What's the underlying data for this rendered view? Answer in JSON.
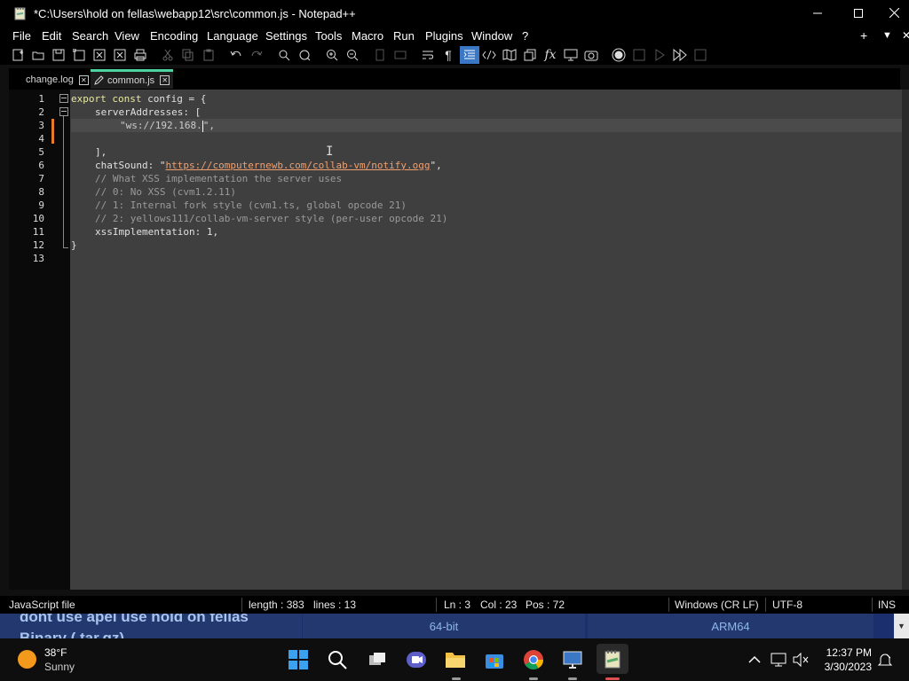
{
  "window": {
    "title": "*C:\\Users\\hold on fellas\\webapp12\\src\\common.js - Notepad++",
    "buttons": {
      "minimize_icon": "minimize-icon",
      "maximize_icon": "maximize-icon",
      "close_icon": "close-icon"
    }
  },
  "menu": {
    "items": [
      "File",
      "Edit",
      "Search",
      "View",
      "Encoding",
      "Language",
      "Settings",
      "Tools",
      "Macro",
      "Run",
      "Plugins",
      "Window",
      "?"
    ],
    "right": [
      "+",
      "▼",
      "✕"
    ]
  },
  "toolbar": {
    "icons": [
      "new-file-icon",
      "open-file-icon",
      "save-icon",
      "save-all-icon",
      "close-icon",
      "close-all-icon",
      "print-icon",
      "cut-icon",
      "copy-icon",
      "paste-icon",
      "undo-icon",
      "redo-icon",
      "find-icon",
      "replace-icon",
      "zoom-in-icon",
      "zoom-out-icon",
      "sync-v-icon",
      "sync-h-icon",
      "word-wrap-icon",
      "show-all-chars-icon",
      "indent-guide-icon",
      "xml-tag-icon",
      "doc-map-icon",
      "doc-list-icon",
      "function-list-icon",
      "folder-workspace-icon",
      "monitor-icon",
      "record-macro-icon",
      "stop-macro-icon",
      "play-macro-icon",
      "run-macro-multiple-icon",
      "save-macro-icon"
    ]
  },
  "tabs": [
    {
      "label": "change.log",
      "active": false
    },
    {
      "label": "common.js",
      "active": true,
      "modified": true
    }
  ],
  "editor": {
    "line_numbers": [
      "1",
      "2",
      "3",
      "4",
      "5",
      "6",
      "7",
      "8",
      "9",
      "10",
      "11",
      "12",
      "13"
    ],
    "lines": {
      "l1_kw1": "export",
      "l1_kw2": "const",
      "l1_rest": " config = {",
      "l2": "serverAddresses: [",
      "l3": "\"ws://192.168.",
      "l3_end": "\",",
      "l5": "],",
      "l6_key": "chatSound: \"",
      "l6_url": "https://computernewb.com/collab-vm/notify.ogg",
      "l6_end": "\",",
      "l7": "// What XSS implementation the server uses",
      "l8": "// 0: No XSS (cvm1.2.11)",
      "l9": "// 1: Internal fork style (cvm1.ts, global opcode 21)",
      "l10": "// 2: yellows111/collab-vm-server style (per-user opcode 21)",
      "l11": "xssImplementation: 1,",
      "l12": "}"
    },
    "current_line": 3
  },
  "status": {
    "file_type": "JavaScript file",
    "length": "length : 383",
    "lines": "lines : 13",
    "ln": "Ln : 3",
    "col": "Col : 23",
    "pos": "Pos : 72",
    "eol": "Windows (CR LF)",
    "encoding": "UTF-8",
    "mode": "INS"
  },
  "background": {
    "text": "dont use apel use hold on fellas",
    "text2": "Binary ( tar.gz)",
    "cell1": "64-bit",
    "cell2": "ARM64"
  },
  "taskbar": {
    "weather_temp": "38°F",
    "weather_desc": "Sunny",
    "time": "12:37 PM",
    "date": "3/30/2023",
    "apps": [
      "start-icon",
      "search-icon",
      "task-view-icon",
      "teams-icon",
      "file-explorer-icon",
      "store-icon",
      "chrome-icon",
      "remote-desktop-icon",
      "notepadpp-icon"
    ]
  },
  "colors": {
    "accent_modified": "#e87b2a",
    "tab_active_bar": "#4dd3a0",
    "editor_bg": "#3f3f3f"
  }
}
